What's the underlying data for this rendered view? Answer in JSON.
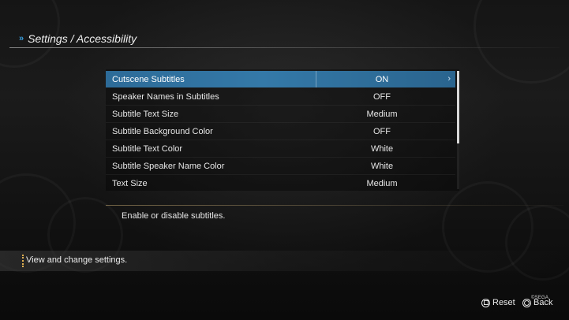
{
  "header": {
    "title": "Settings / Accessibility",
    "chevron": "»"
  },
  "settings": {
    "rows": [
      {
        "label": "Cutscene Subtitles",
        "value": "ON",
        "selected": true
      },
      {
        "label": "Speaker Names in Subtitles",
        "value": "OFF",
        "selected": false
      },
      {
        "label": "Subtitle Text Size",
        "value": "Medium",
        "selected": false
      },
      {
        "label": "Subtitle Background Color",
        "value": "OFF",
        "selected": false
      },
      {
        "label": "Subtitle Text Color",
        "value": "White",
        "selected": false
      },
      {
        "label": "Subtitle Speaker Name Color",
        "value": "White",
        "selected": false
      },
      {
        "label": "Text Size",
        "value": "Medium",
        "selected": false
      }
    ],
    "selected_arrow": "›"
  },
  "description": {
    "text": "Enable or disable subtitles."
  },
  "help_bar": {
    "text": "View and change settings."
  },
  "prompts": {
    "reset_label": "Reset",
    "back_label": "Back",
    "brand": "©SEGA"
  },
  "colors": {
    "accent": "#3479a8",
    "chevron": "#3aa0e0",
    "help_marker": "#e0b050"
  },
  "icons": {
    "reset": "square-button-icon",
    "back": "circle-button-icon"
  }
}
